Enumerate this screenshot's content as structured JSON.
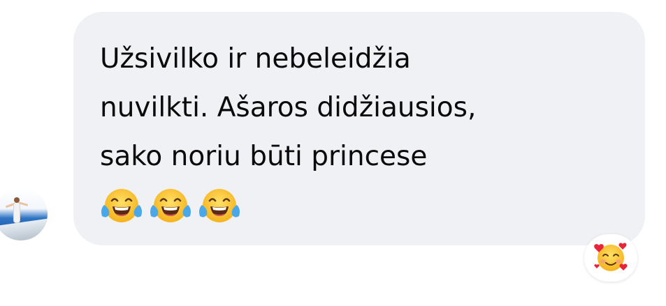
{
  "message": {
    "lines": [
      "Užsivilko ir nebeleidžia",
      "nuvilkti. Ašaros didžiausios,",
      "sako noriu būti princese"
    ],
    "emojis": [
      "tears-of-joy-icon",
      "tears-of-joy-icon",
      "tears-of-joy-icon"
    ]
  },
  "reaction": {
    "emoji": "smiling-face-with-hearts-icon"
  },
  "colors": {
    "bubble_bg": "#f0f1f5",
    "text": "#0a0a0a",
    "page_bg": "#ffffff"
  }
}
